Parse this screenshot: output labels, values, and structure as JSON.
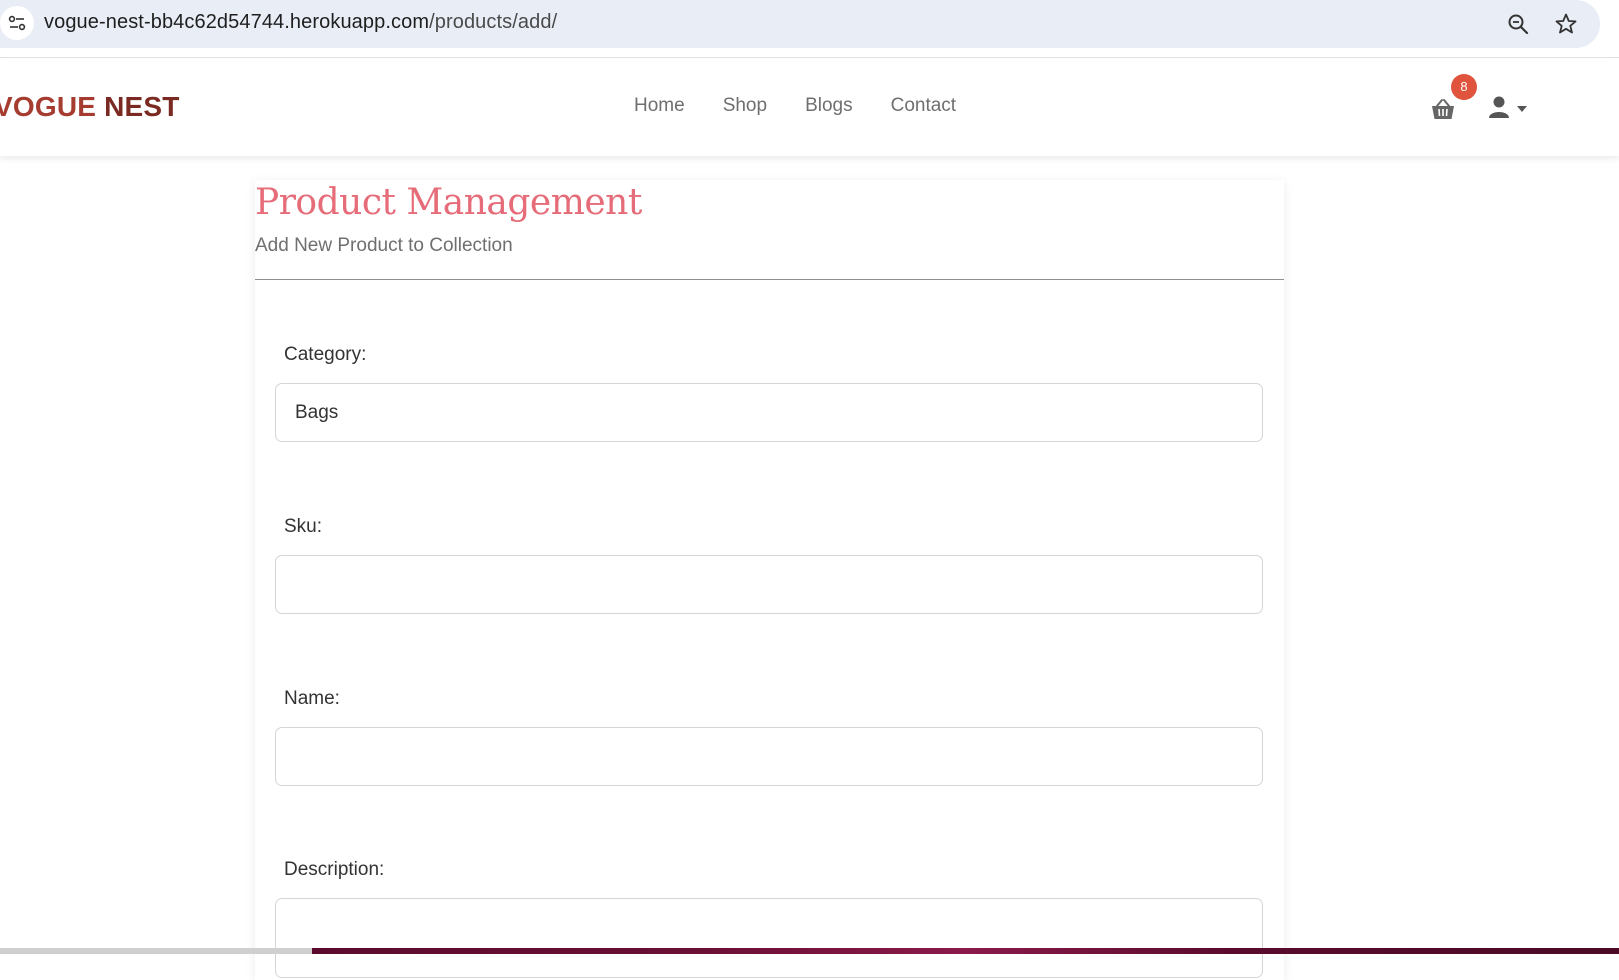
{
  "browser": {
    "url_host": "vogue-nest-bb4c62d54744.herokuapp.com",
    "url_path": "/products/add/",
    "icons": [
      "site-info-icon",
      "zoom-icon",
      "star-icon"
    ]
  },
  "navbar": {
    "brand_part1": "VOGUE",
    "brand_part2": "NEST",
    "links": [
      "Home",
      "Shop",
      "Blogs",
      "Contact"
    ],
    "cart_count": "8",
    "icons": [
      "basket-icon",
      "user-icon",
      "caret-down-icon"
    ]
  },
  "page": {
    "title": "Product Management",
    "subtitle": "Add New Product to Collection"
  },
  "form": {
    "category_label": "Category:",
    "category_value": "Bags",
    "sku_label": "Sku:",
    "sku_value": "",
    "name_label": "Name:",
    "name_value": "",
    "description_label": "Description:",
    "description_value": ""
  },
  "colors": {
    "brand": "#a53c2f",
    "title": "#e56c78",
    "badge": "#e0533d"
  }
}
